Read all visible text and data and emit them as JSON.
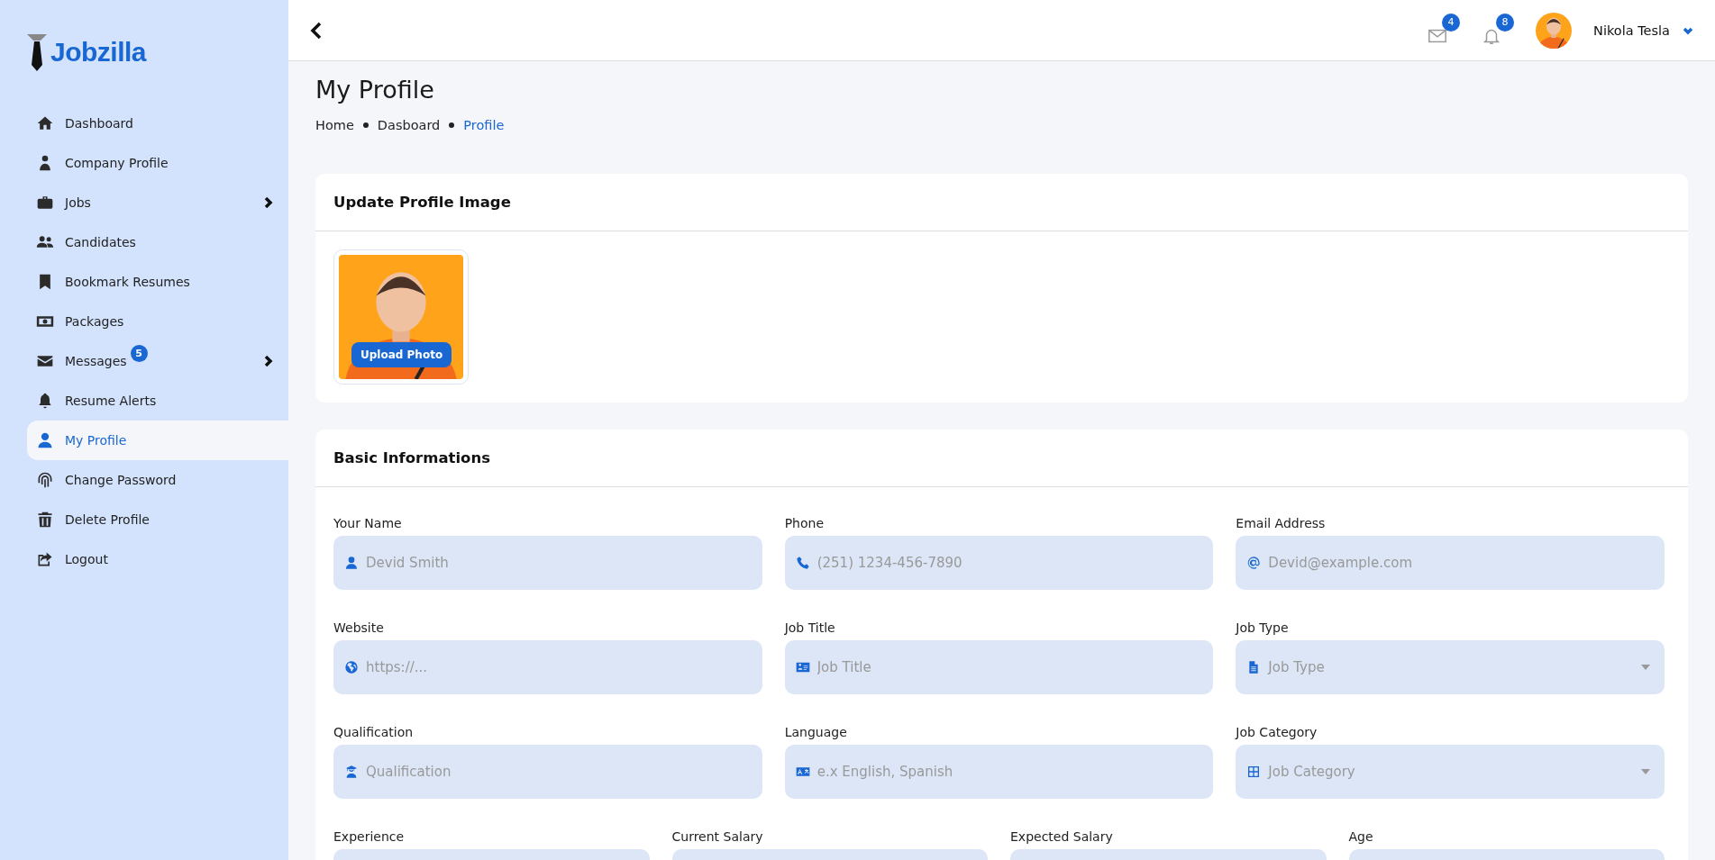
{
  "brand": {
    "name": "Jobzilla"
  },
  "sidebar": {
    "items": [
      {
        "label": "Dashboard",
        "selected": false,
        "expandable": false
      },
      {
        "label": "Company Profile",
        "selected": false,
        "expandable": false
      },
      {
        "label": "Jobs",
        "selected": false,
        "expandable": true
      },
      {
        "label": "Candidates",
        "selected": false,
        "expandable": false
      },
      {
        "label": "Bookmark Resumes",
        "selected": false,
        "expandable": false
      },
      {
        "label": "Packages",
        "selected": false,
        "expandable": false
      },
      {
        "label": "Messages",
        "selected": false,
        "expandable": true,
        "badge": "5"
      },
      {
        "label": "Resume Alerts",
        "selected": false,
        "expandable": false
      },
      {
        "label": "My Profile",
        "selected": true,
        "expandable": false
      },
      {
        "label": "Change Password",
        "selected": false,
        "expandable": false
      },
      {
        "label": "Delete Profile",
        "selected": false,
        "expandable": false
      },
      {
        "label": "Logout",
        "selected": false,
        "expandable": false
      }
    ]
  },
  "header": {
    "mail_badge": "4",
    "notification_badge": "8",
    "user_name": "Nikola Tesla"
  },
  "page_title": "My Profile",
  "breadcrumb": [
    {
      "label": "Home",
      "selected": false
    },
    {
      "label": "Dasboard",
      "selected": false
    },
    {
      "label": "Profile",
      "selected": true
    }
  ],
  "image_card": {
    "title": "Update Profile Image",
    "upload_button": "Upload Photo"
  },
  "info_card": {
    "title": "Basic Informations",
    "rows": [
      {
        "fields": [
          {
            "label": "Your Name",
            "placeholder": "Devid Smith",
            "kind": "text"
          },
          {
            "label": "Phone",
            "placeholder": "(251) 1234-456-7890",
            "kind": "text"
          },
          {
            "label": "Email Address",
            "placeholder": "Devid@example.com",
            "kind": "text"
          }
        ]
      },
      {
        "fields": [
          {
            "label": "Website",
            "placeholder": "https://...",
            "kind": "text"
          },
          {
            "label": "Job Title",
            "placeholder": "Job Title",
            "kind": "text"
          },
          {
            "label": "Job Type",
            "placeholder": "Job Type",
            "kind": "select"
          }
        ]
      },
      {
        "fields": [
          {
            "label": "Qualification",
            "placeholder": "Qualification",
            "kind": "text"
          },
          {
            "label": "Language",
            "placeholder": "e.x English, Spanish",
            "kind": "text"
          },
          {
            "label": "Job Category",
            "placeholder": "Job Category",
            "kind": "select"
          }
        ]
      },
      {
        "fields": [
          {
            "label": "Experience",
            "kind": "text"
          },
          {
            "label": "Current Salary",
            "kind": "text"
          },
          {
            "label": "Expected Salary",
            "kind": "text"
          },
          {
            "label": "Age",
            "kind": "text"
          }
        ]
      }
    ]
  }
}
